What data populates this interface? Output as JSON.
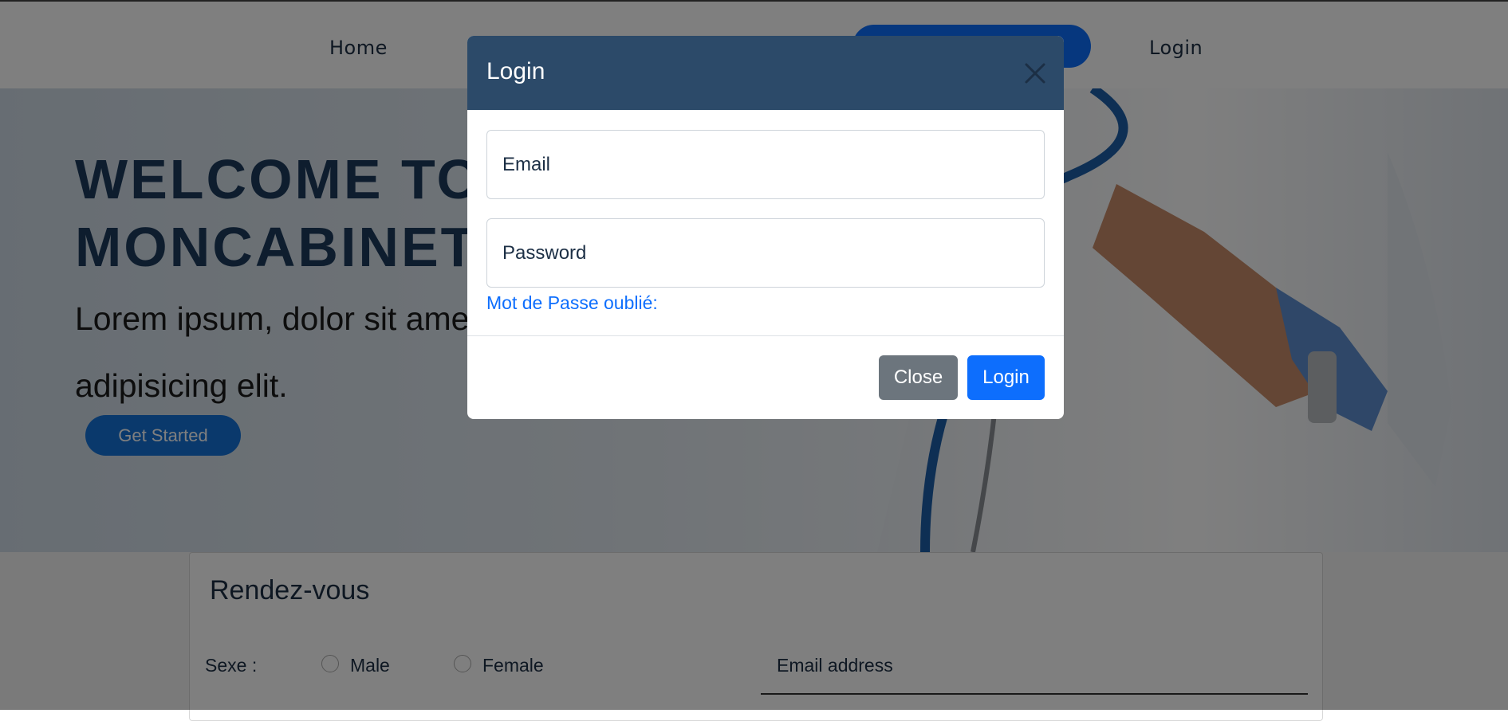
{
  "navbar": {
    "home_label": "Home",
    "login_label": "Login"
  },
  "hero": {
    "title_line1": "WELCOME TO",
    "title_line2": "MONCABINET",
    "subtitle": "Lorem ipsum, dolor sit amet consectetur adipisicing elit.",
    "cta_label": "Get Started"
  },
  "appointment": {
    "title": "Rendez-vous",
    "sexe_label": "Sexe :",
    "options": [
      "Male",
      "Female"
    ],
    "email_placeholder": "Email address"
  },
  "modal": {
    "title": "Login",
    "email_placeholder": "Email",
    "password_placeholder": "Password",
    "forgot_label": "Mot de Passe oublié:",
    "close_label": "Close",
    "login_label": "Login"
  },
  "colors": {
    "primary": "#0d6efd",
    "modal_header": "#2c4a69",
    "secondary": "#6c757d"
  }
}
